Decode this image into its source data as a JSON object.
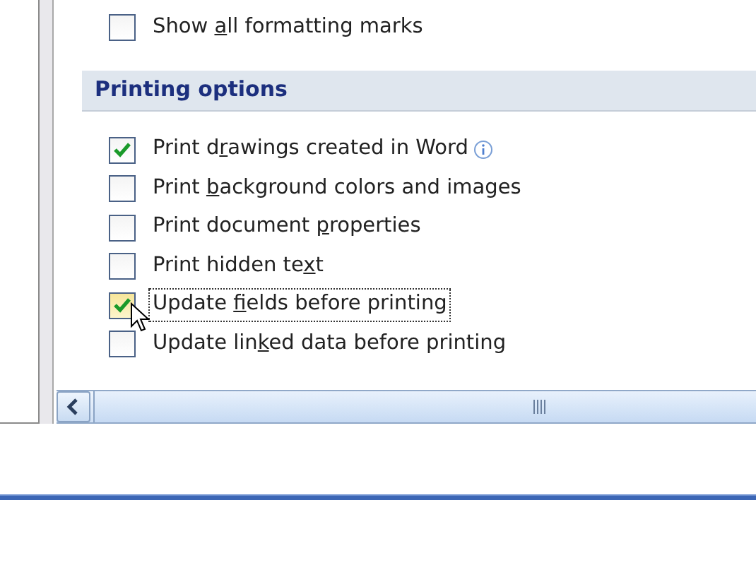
{
  "top_options": [
    {
      "before": "Show ",
      "key": "a",
      "after": "ll formatting marks",
      "checked": false,
      "focused": false,
      "info": false
    }
  ],
  "section": {
    "title": "Printing options"
  },
  "options": [
    {
      "before": "Print d",
      "key": "r",
      "after": "awings created in Word",
      "checked": true,
      "focused": false,
      "info": true
    },
    {
      "before": "Print ",
      "key": "b",
      "after": "ackground colors and images",
      "checked": false,
      "focused": false,
      "info": false
    },
    {
      "before": "Print document ",
      "key": "p",
      "after": "roperties",
      "checked": false,
      "focused": false,
      "info": false
    },
    {
      "before": "Print hidden te",
      "key": "x",
      "after": "t",
      "checked": false,
      "focused": false,
      "info": false
    },
    {
      "before": "Update ",
      "key": "f",
      "after": "ields before printing",
      "checked": true,
      "focused": true,
      "info": false
    },
    {
      "before": "Update lin",
      "key": "k",
      "after": "ed data before printing",
      "checked": false,
      "focused": false,
      "info": false
    }
  ]
}
